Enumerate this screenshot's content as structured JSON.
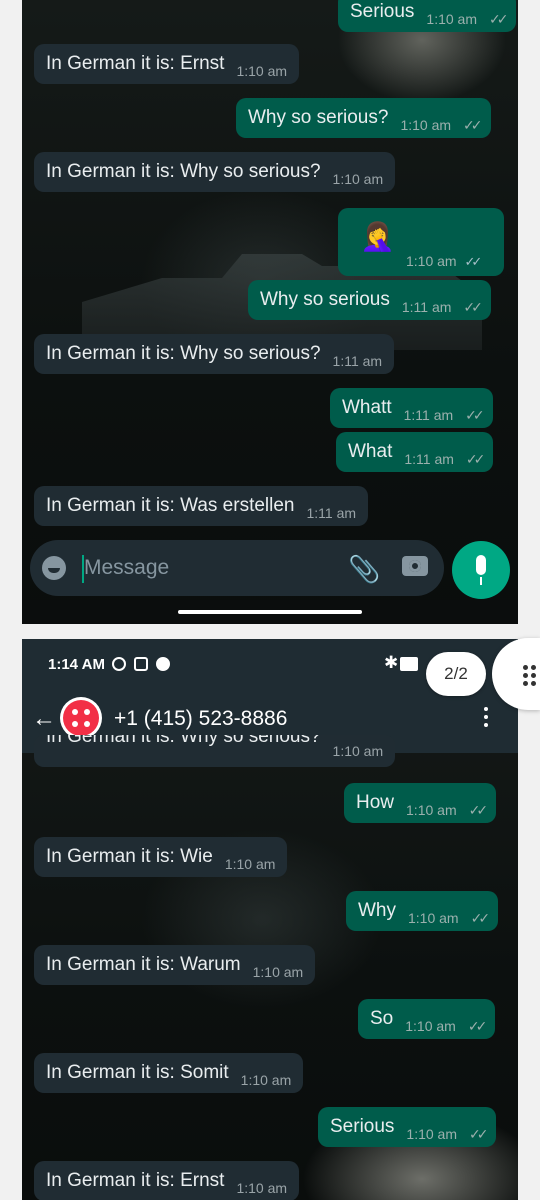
{
  "shot1": {
    "messages": [
      {
        "dir": "out",
        "text": "Serious",
        "time": "1:10 am"
      },
      {
        "dir": "in",
        "text": "In German it is: Ernst",
        "time": "1:10 am"
      },
      {
        "dir": "out",
        "text": "Why so serious?",
        "time": "1:10 am"
      },
      {
        "dir": "in",
        "text": "In German it is: Why so serious?",
        "time": "1:10 am"
      },
      {
        "dir": "out",
        "text": "🤦‍♀️",
        "time": "1:10 am"
      },
      {
        "dir": "out",
        "text": "Why so serious",
        "time": "1:11 am"
      },
      {
        "dir": "in",
        "text": "In German it is: Why so serious?",
        "time": "1:11 am"
      },
      {
        "dir": "out",
        "text": "Whatt",
        "time": "1:11 am"
      },
      {
        "dir": "out",
        "text": "What",
        "time": "1:11 am"
      },
      {
        "dir": "in",
        "text": "In German it is: Was erstellen",
        "time": "1:11 am"
      }
    ],
    "input_placeholder": "Message"
  },
  "shot2": {
    "status_time": "1:14 AM",
    "contact_name": "+1 (415) 523-8886",
    "partial_message": {
      "text": "In German it is: Why so serious?",
      "time": "1:10 am"
    },
    "messages": [
      {
        "dir": "out",
        "text": "How",
        "time": "1:10 am"
      },
      {
        "dir": "in",
        "text": "In German it is: Wie",
        "time": "1:10 am"
      },
      {
        "dir": "out",
        "text": "Why",
        "time": "1:10 am"
      },
      {
        "dir": "in",
        "text": "In German it is: Warum",
        "time": "1:10 am"
      },
      {
        "dir": "out",
        "text": "So",
        "time": "1:10 am"
      },
      {
        "dir": "in",
        "text": "In German it is: Somit",
        "time": "1:10 am"
      },
      {
        "dir": "out",
        "text": "Serious",
        "time": "1:10 am"
      },
      {
        "dir": "in",
        "text": "In German it is: Ernst",
        "time": "1:10 am"
      }
    ]
  },
  "viewer": {
    "page_indicator": "2/2"
  },
  "icons": {
    "read_ticks": "double-check-icon",
    "emoji": "emoji-icon",
    "attach": "paperclip-icon",
    "camera": "camera-icon",
    "mic": "microphone-icon",
    "back": "back-arrow-icon",
    "menu": "more-vertical-icon",
    "apps": "grid-icon",
    "bluetooth": "bluetooth-icon"
  },
  "colors": {
    "incoming": "#202c33",
    "outgoing": "#005c4b",
    "accent": "#00a884",
    "header": "#1f2c33"
  }
}
